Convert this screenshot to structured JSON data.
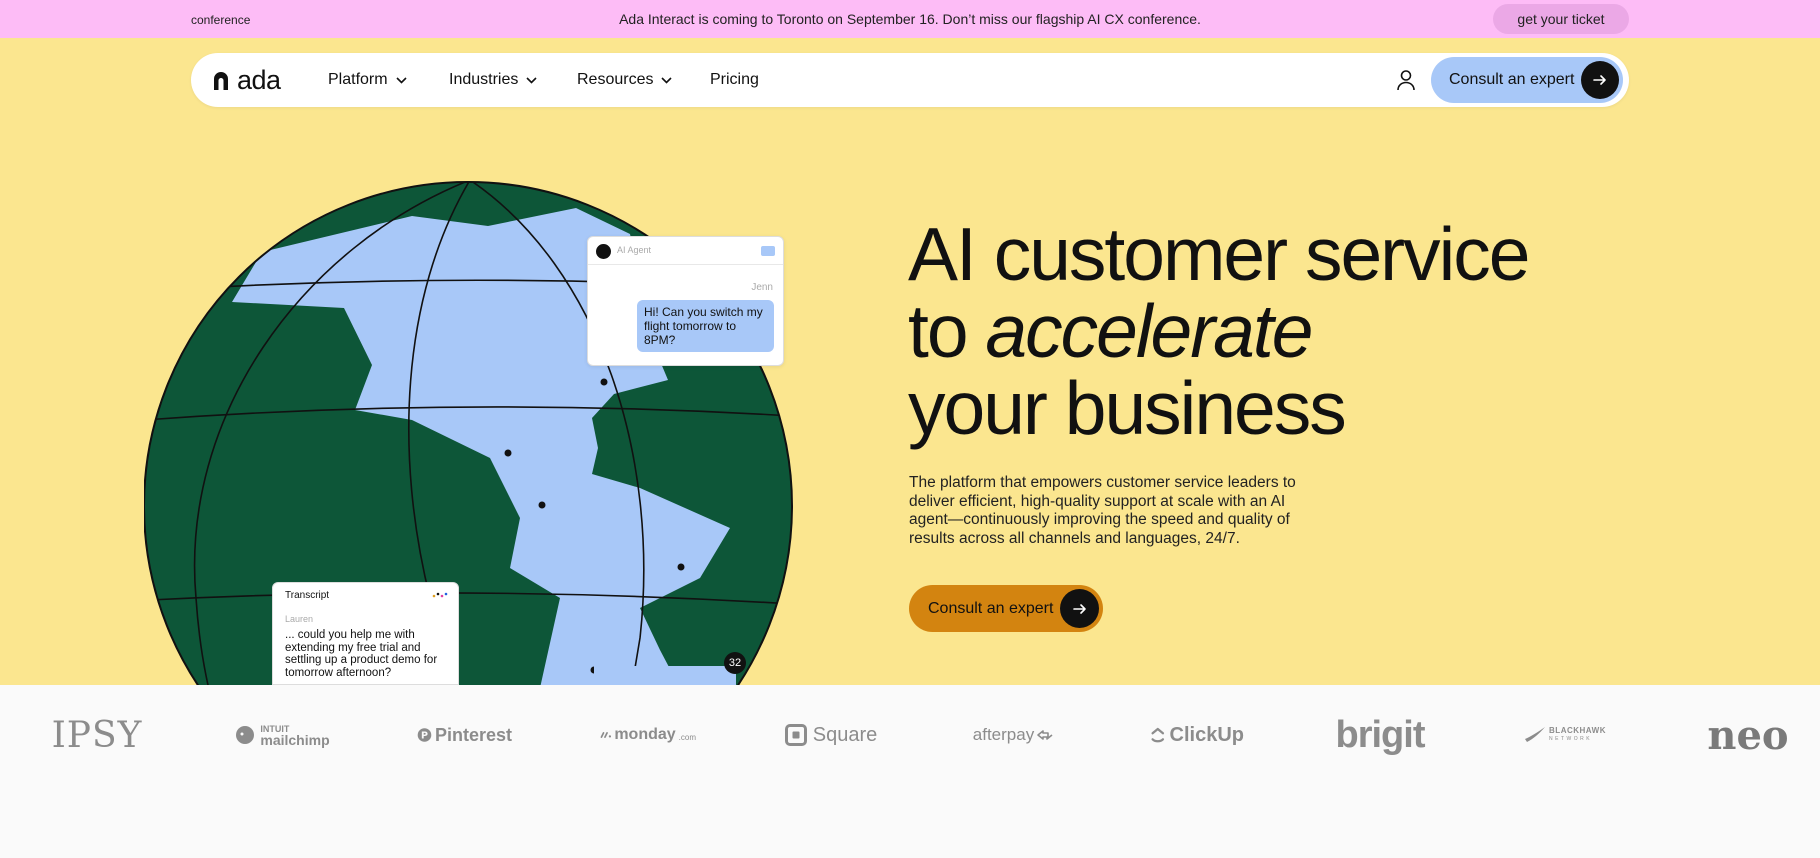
{
  "announcement": {
    "tag": "conference",
    "message": "Ada Interact is coming to Toronto on September 16. Don’t miss our flagship AI CX conference.",
    "ticket_label": "get your ticket"
  },
  "nav": {
    "logo_text": "ada",
    "items": [
      {
        "label": "Platform",
        "has_dropdown": true
      },
      {
        "label": "Industries",
        "has_dropdown": true
      },
      {
        "label": "Resources",
        "has_dropdown": true
      },
      {
        "label": "Pricing",
        "has_dropdown": false
      }
    ],
    "user_icon": "user-icon",
    "cta_label": "Consult an expert"
  },
  "hero": {
    "headline": {
      "line1": "AI customer service",
      "line2_prefix": "to ",
      "line2_emphasis": "accelerate",
      "line3": "your business"
    },
    "subcopy": "The platform that empowers customer service leaders to deliver efficient, high-quality support at scale with an AI agent—continuously improving the speed and quality of results across all channels and languages, 24/7.",
    "cta_label": "Consult an expert"
  },
  "chat_card": {
    "agent_name": "AI Agent",
    "sender": "Jenn",
    "message": "Hi! Can you switch my flight tomorrow to 8PM?"
  },
  "transcript_card": {
    "title": "Transcript",
    "sender": "Lauren",
    "message": "... could you help me with extending my free trial and settling up a product demo for tomorrow afternoon?"
  },
  "notification_badge": "32",
  "logos": [
    {
      "name": "IPSY",
      "text": "IPSY"
    },
    {
      "name": "Intuit Mailchimp",
      "text_top": "INTUIT",
      "text": "mailchimp"
    },
    {
      "name": "Pinterest",
      "text": "Pinterest"
    },
    {
      "name": "monday.com",
      "text": "monday",
      "suffix": ".com"
    },
    {
      "name": "Square",
      "text": "Square"
    },
    {
      "name": "afterpay",
      "text": "afterpay"
    },
    {
      "name": "ClickUp",
      "text": "ClickUp"
    },
    {
      "name": "brigit",
      "text": "brigit"
    },
    {
      "name": "Blackhawk Network",
      "text": "BLACKHAWK",
      "text_sub": "NETWORK"
    },
    {
      "name": "neo",
      "text": "neo"
    }
  ],
  "colors": {
    "announcement_bg": "#fdbcf6",
    "hero_bg": "#fbe68f",
    "globe_green": "#0d5638",
    "globe_blue": "#a8c8f8",
    "nav_cta_bg": "#a8c8f8",
    "hero_cta_bg": "#d38410",
    "logo_gray": "#8c8c8c"
  }
}
